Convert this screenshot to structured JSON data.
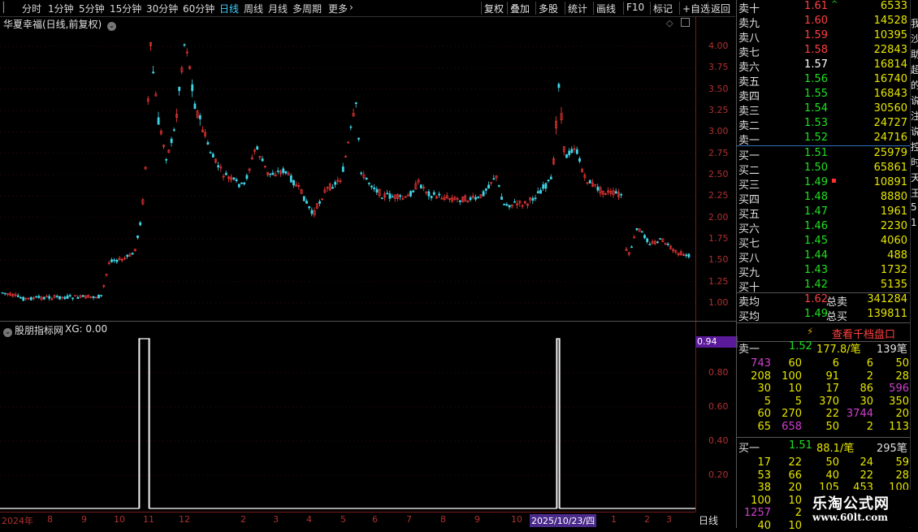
{
  "toolbar": {
    "periods": [
      "分时",
      "1分钟",
      "5分钟",
      "15分钟",
      "30分钟",
      "60分钟",
      "日线",
      "周线",
      "月线",
      "多周期",
      "更多"
    ],
    "active_period": "日线",
    "more_icon": "chevron-right-icon",
    "buttons": [
      "复权",
      "叠加",
      "多股",
      "统计",
      "画线",
      "F10",
      "标记",
      "+自选",
      "返回"
    ]
  },
  "chart": {
    "title": "华夏幸福(日线,前复权)",
    "y_ticks": [
      "4.00",
      "3.75",
      "3.50",
      "3.25",
      "3.00",
      "2.75",
      "2.50",
      "2.25",
      "2.00",
      "1.75",
      "1.50",
      "1.25",
      "1.00"
    ],
    "x_ticks": [
      "2024年",
      "8",
      "9",
      "10",
      "11",
      "12",
      "2",
      "3",
      "4",
      "5",
      "6",
      "7",
      "8",
      "9",
      "10",
      "1",
      "2",
      "3"
    ],
    "cursor_date": "2025/10/23/四",
    "colors": {
      "up": "#ff3b3b",
      "down": "#3fd6e8",
      "axis": "#b03030",
      "indicator_line": "#ffffff"
    }
  },
  "indicator": {
    "title": "股朋指标网",
    "xg": "XG: 0.00",
    "value_tag": "0.94",
    "y_ticks": [
      "0.80",
      "0.60",
      "0.40",
      "0.20"
    ]
  },
  "period_tab": "日线",
  "order_book": {
    "sells": [
      {
        "label": "卖十",
        "price": "1.61",
        "vol": "6533",
        "color": "red",
        "mark": "^"
      },
      {
        "label": "卖九",
        "price": "1.60",
        "vol": "14528",
        "color": "red"
      },
      {
        "label": "卖八",
        "price": "1.59",
        "vol": "10395",
        "color": "red"
      },
      {
        "label": "卖七",
        "price": "1.58",
        "vol": "22843",
        "color": "red"
      },
      {
        "label": "卖六",
        "price": "1.57",
        "vol": "16814",
        "color": "wht"
      },
      {
        "label": "卖五",
        "price": "1.56",
        "vol": "16740",
        "color": "grn"
      },
      {
        "label": "卖四",
        "price": "1.55",
        "vol": "16843",
        "color": "grn"
      },
      {
        "label": "卖三",
        "price": "1.54",
        "vol": "30560",
        "color": "grn"
      },
      {
        "label": "卖二",
        "price": "1.53",
        "vol": "24727",
        "color": "grn"
      },
      {
        "label": "卖一",
        "price": "1.52",
        "vol": "24716",
        "color": "grn"
      }
    ],
    "buys": [
      {
        "label": "买一",
        "price": "1.51",
        "vol": "25979",
        "color": "grn"
      },
      {
        "label": "买二",
        "price": "1.50",
        "vol": "65861",
        "color": "grn"
      },
      {
        "label": "买三",
        "price": "1.49",
        "vol": "10891",
        "color": "grn",
        "mark": "▪"
      },
      {
        "label": "买四",
        "price": "1.48",
        "vol": "8880",
        "color": "grn"
      },
      {
        "label": "买五",
        "price": "1.47",
        "vol": "1961",
        "color": "grn"
      },
      {
        "label": "买六",
        "price": "1.46",
        "vol": "2230",
        "color": "grn"
      },
      {
        "label": "买七",
        "price": "1.45",
        "vol": "4060",
        "color": "grn"
      },
      {
        "label": "买八",
        "price": "1.44",
        "vol": "488",
        "color": "grn"
      },
      {
        "label": "买九",
        "price": "1.43",
        "vol": "1732",
        "color": "grn"
      },
      {
        "label": "买十",
        "price": "1.42",
        "vol": "5135",
        "color": "grn"
      }
    ],
    "avg": [
      {
        "label": "卖均",
        "price": "1.62",
        "tlabel": "总卖",
        "vol": "341284",
        "color": "red"
      },
      {
        "label": "买均",
        "price": "1.49",
        "tlabel": "总买",
        "vol": "139811",
        "color": "grn"
      }
    ]
  },
  "qiandang": {
    "label": "查看千档盘口",
    "icon": "lightning-icon"
  },
  "sell_queue": {
    "label": "卖一",
    "price": "1.52",
    "avg": "177.8/笔",
    "count": "139笔",
    "rows": [
      [
        "743",
        "60",
        "6",
        "6",
        "50"
      ],
      [
        "208",
        "100",
        "91",
        "2",
        "28"
      ],
      [
        "30",
        "10",
        "17",
        "86",
        "596"
      ],
      [
        "5",
        "5",
        "370",
        "30",
        "350"
      ],
      [
        "60",
        "270",
        "22",
        "3744",
        "20"
      ],
      [
        "65",
        "658",
        "50",
        "2",
        "113"
      ]
    ],
    "highlight": [
      "743",
      "596",
      "3744",
      "658"
    ]
  },
  "buy_queue": {
    "label": "买一",
    "price": "1.51",
    "avg": "88.1/笔",
    "count": "295笔",
    "rows": [
      [
        "17",
        "22",
        "50",
        "24",
        "59"
      ],
      [
        "53",
        "66",
        "40",
        "22",
        "28"
      ],
      [
        "38",
        "20",
        "105",
        "453",
        "100"
      ],
      [
        "100",
        "10",
        "",
        "",
        ""
      ],
      [
        "1257",
        "2",
        "",
        "",
        ""
      ],
      [
        "40",
        "10",
        "",
        "",
        ""
      ]
    ],
    "highlight": [
      "1257"
    ]
  },
  "edge_chars": [
    "我",
    "沙",
    "助",
    "超",
    "的",
    "说",
    "注",
    "说",
    "控",
    "时",
    "天",
    "王",
    "5",
    "1"
  ],
  "watermark": {
    "title": "乐淘公式网",
    "url": "www.60lt.com"
  }
}
